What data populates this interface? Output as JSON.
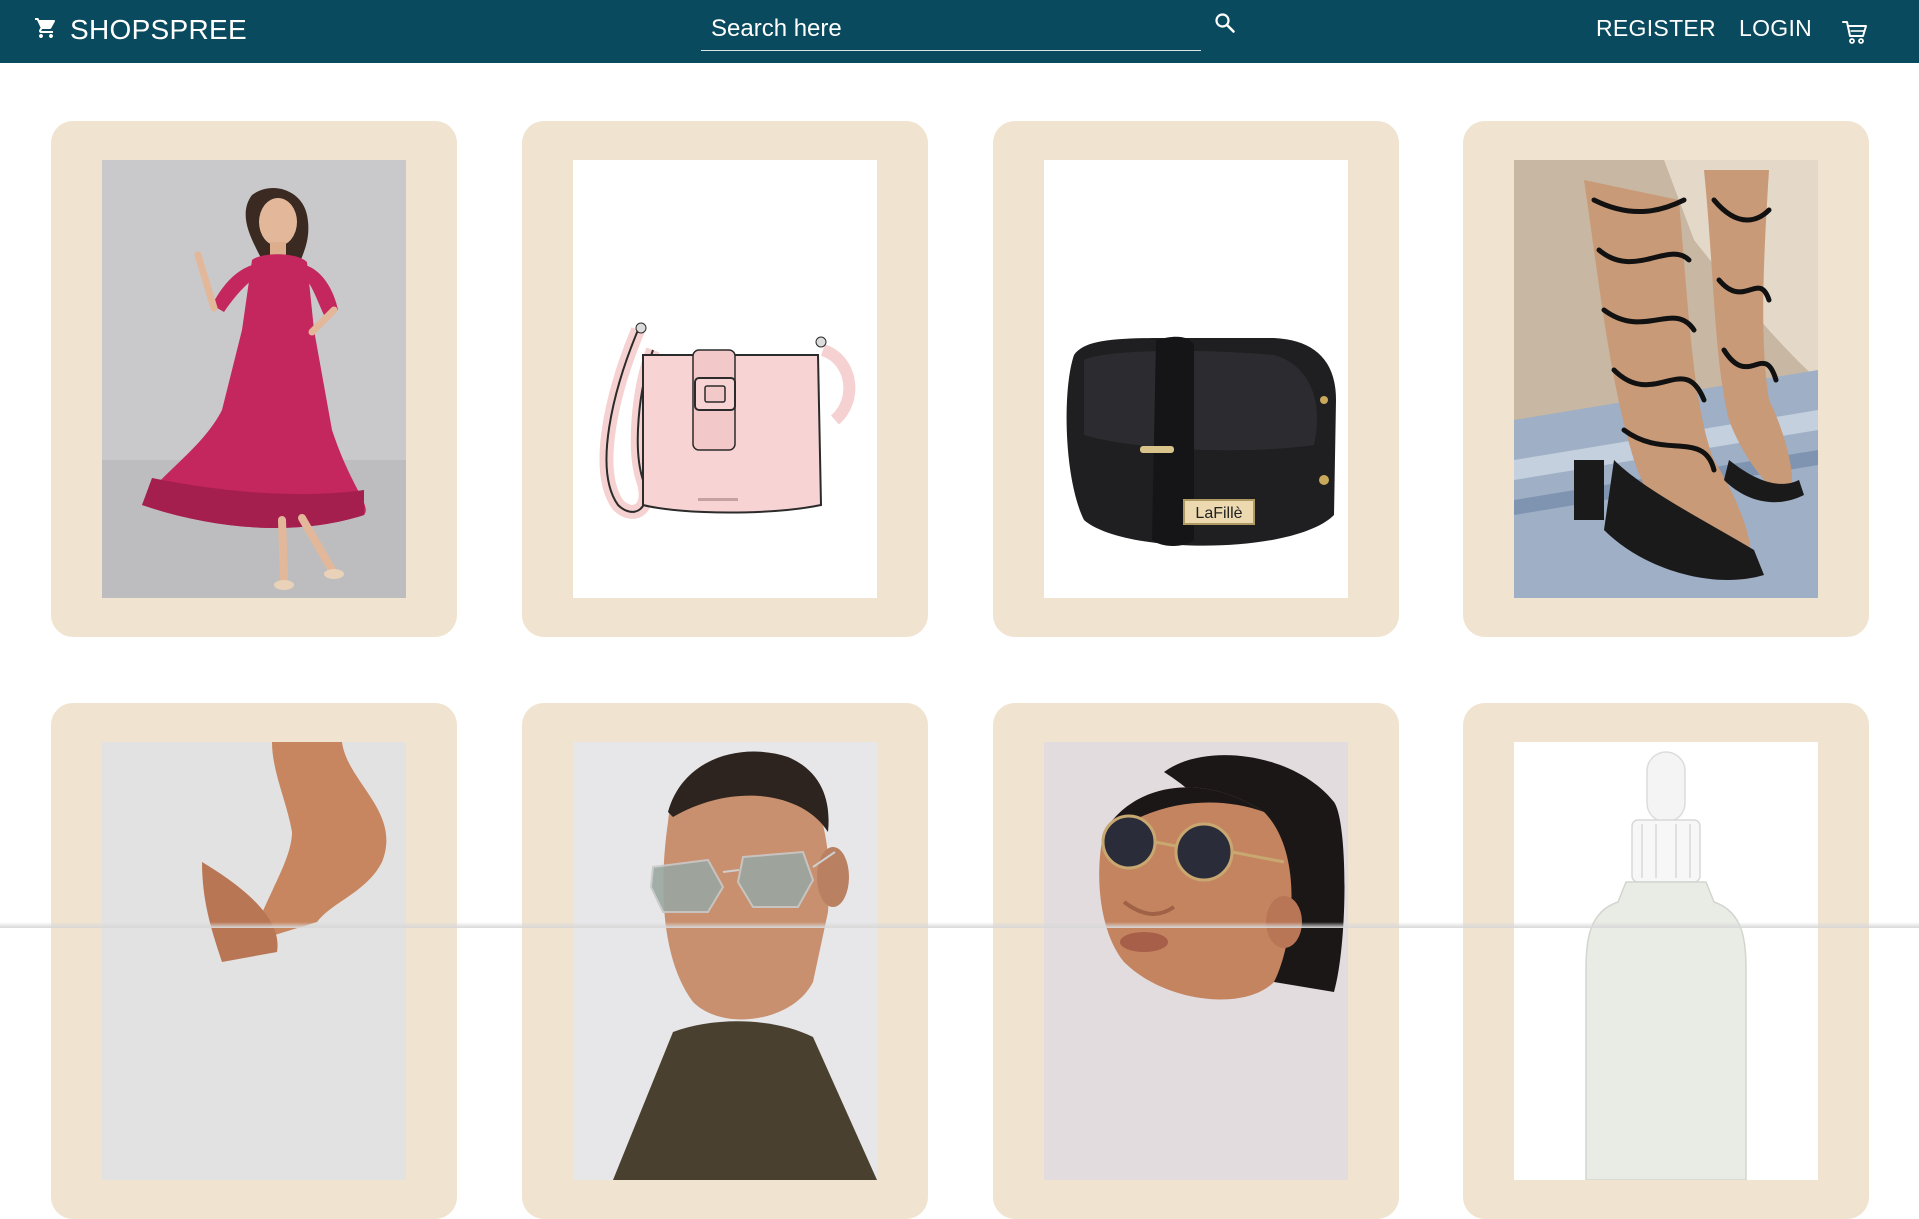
{
  "header": {
    "brand_name": "SHOPSPREE",
    "brand_icon": "shopping-cart-icon",
    "search_placeholder": "Search here",
    "search_icon": "search-icon",
    "register_label": "REGISTER",
    "login_label": "LOGIN",
    "cart_icon": "cart-outline-icon"
  },
  "colors": {
    "navbar": "#0a4a5e",
    "card": "#f0e3d0",
    "page": "#ffffff"
  },
  "products": [
    {
      "image": "pink-maxi-dress"
    },
    {
      "image": "pink-crossbody-bag"
    },
    {
      "image": "black-crossbody-bag",
      "brand_text": "LaFillè"
    },
    {
      "image": "black-lace-up-heeled-sandals"
    },
    {
      "image": "legs-model"
    },
    {
      "image": "man-hexagonal-sunglasses"
    },
    {
      "image": "woman-round-sunglasses"
    },
    {
      "image": "dropper-serum-bottle"
    }
  ]
}
